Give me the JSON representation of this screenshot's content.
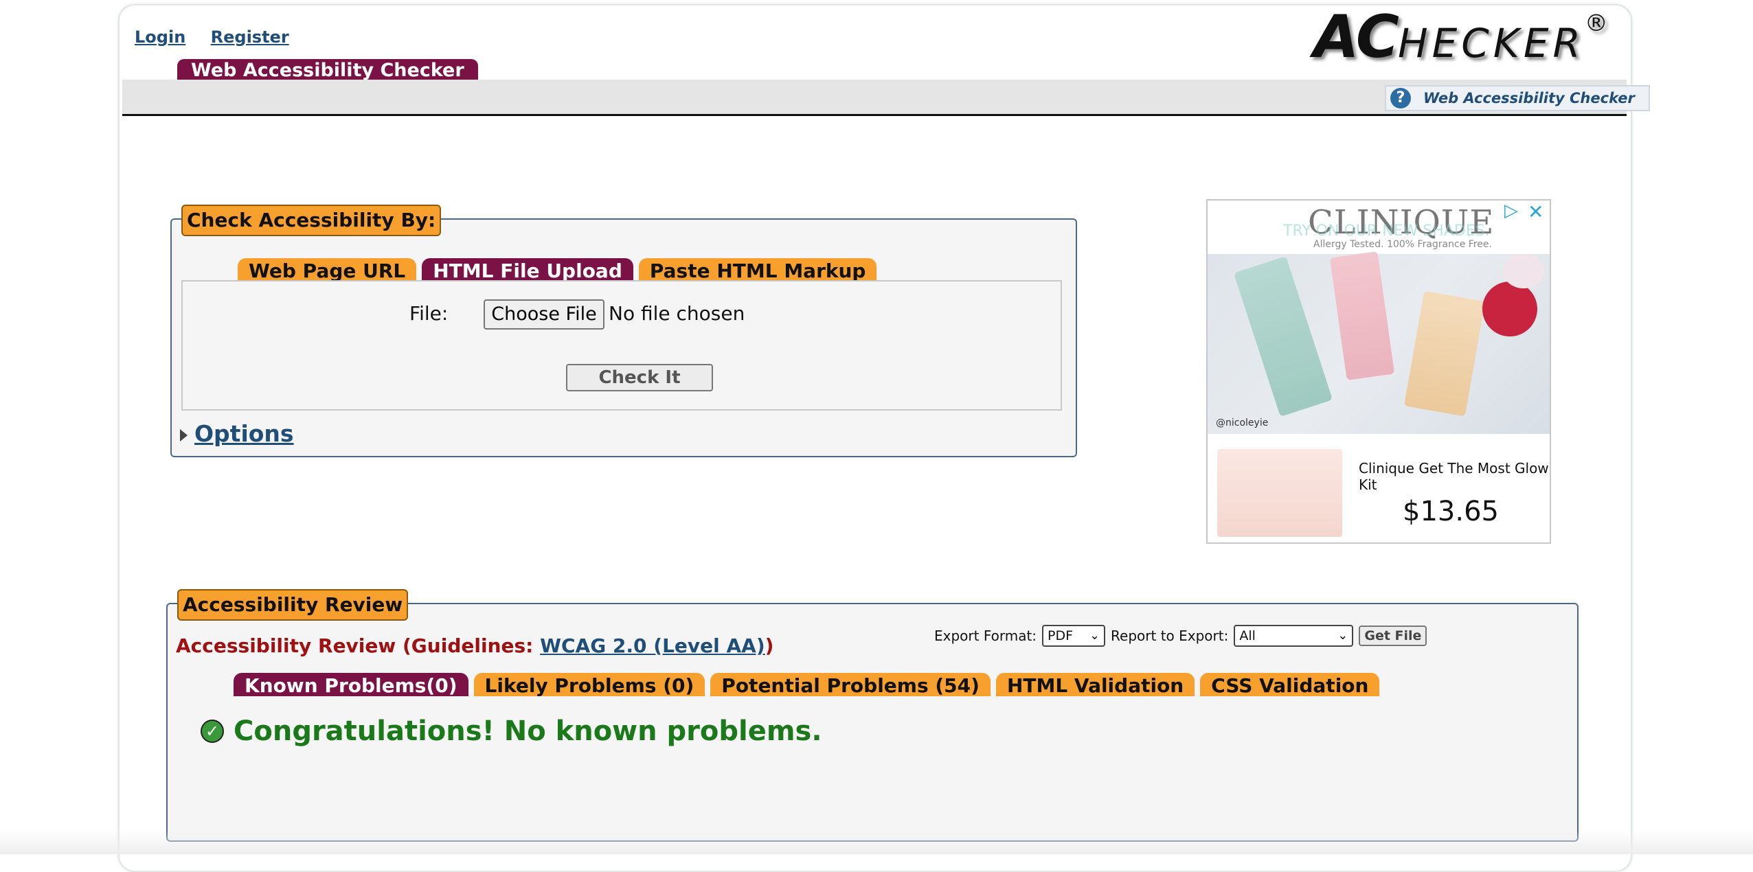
{
  "nav": {
    "login": "Login",
    "register": "Register"
  },
  "logo": {
    "big": "AC",
    "rest": "HECKER",
    "reg": "®"
  },
  "site_tab": "Web Accessibility Checker",
  "help_link": "Web Accessibility Checker",
  "check": {
    "legend": "Check Accessibility By:",
    "tabs": [
      {
        "label": "Web Page URL",
        "active": false
      },
      {
        "label": "HTML File Upload",
        "active": true
      },
      {
        "label": "Paste HTML Markup",
        "active": false
      }
    ],
    "file_label": "File:",
    "choose_button": "Choose File",
    "no_file": "No file chosen",
    "check_button": "Check It",
    "options": "Options"
  },
  "ad": {
    "brand": "CLINIQUE",
    "subtitle": "TRY ON OUR NEW SHADES.",
    "tagline": "Allergy Tested. 100% Fragrance Free.",
    "credit": "@nicoleyie",
    "product": "Clinique Get The Most Glow Kit",
    "price": "$13.65"
  },
  "review": {
    "legend": "Accessibility Review",
    "title_prefix": "Accessibility Review (Guidelines: ",
    "guideline_link": "WCAG 2.0 (Level AA)",
    "title_suffix": ")",
    "export_format_label": "Export Format:",
    "export_format_value": "PDF",
    "report_label": "Report to Export:",
    "report_value": "All",
    "get_file": "Get File",
    "tabs": [
      {
        "label": "Known Problems(0)",
        "active": true
      },
      {
        "label": "Likely Problems (0)",
        "active": false
      },
      {
        "label": "Potential Problems (54)",
        "active": false
      },
      {
        "label": "HTML Validation",
        "active": false
      },
      {
        "label": "CSS Validation",
        "active": false
      }
    ],
    "message": "Congratulations! No known problems."
  },
  "colors": {
    "accent_orange": "#f7a02e",
    "accent_maroon": "#7a1246",
    "link_blue": "#1f4e79",
    "success_green": "#1a7a1a"
  }
}
